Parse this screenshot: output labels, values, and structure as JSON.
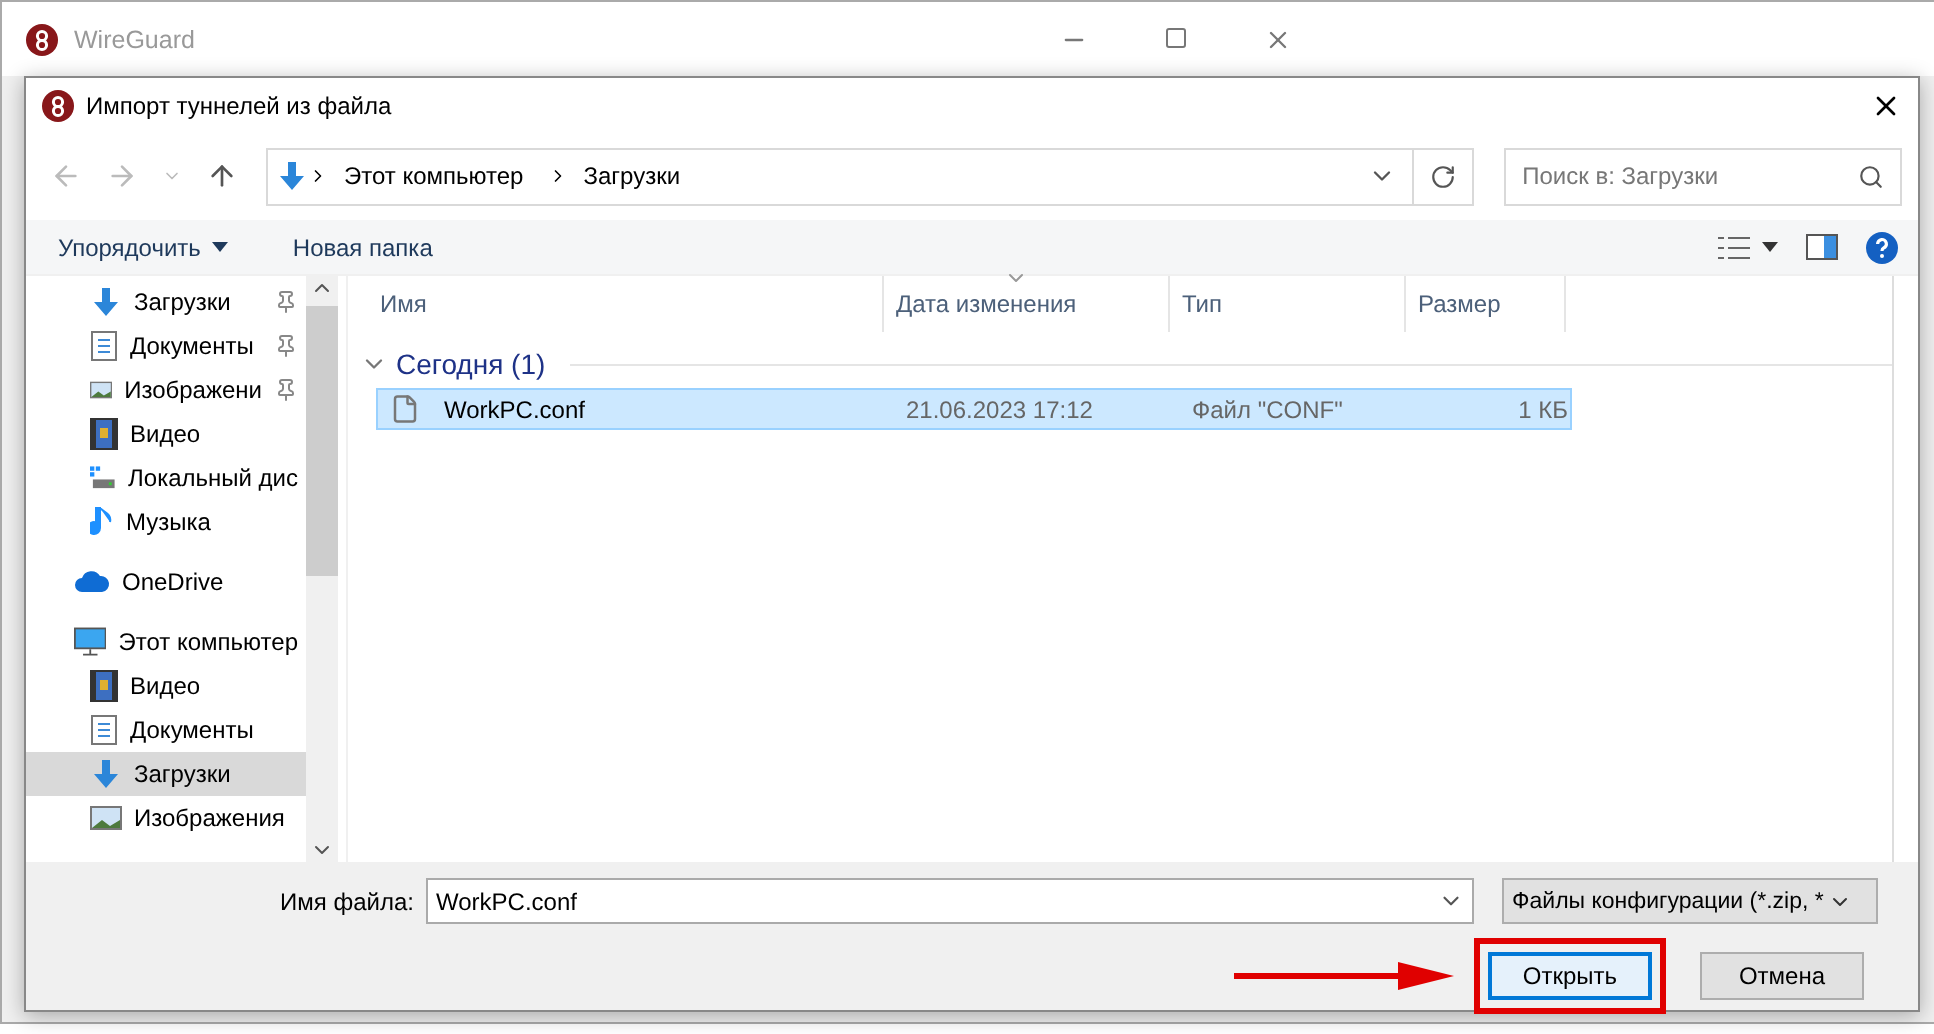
{
  "back_window": {
    "title": "WireGuard"
  },
  "dialog": {
    "title": "Импорт туннелей из файла"
  },
  "address": {
    "path": [
      "Этот компьютер",
      "Загрузки"
    ]
  },
  "search": {
    "placeholder": "Поиск в: Загрузки"
  },
  "toolbar": {
    "organize": "Упорядочить",
    "new_folder": "Новая папка"
  },
  "sidebar": {
    "items": [
      {
        "label": "Загрузки",
        "kind": "downloads",
        "pinned": true,
        "selected": false
      },
      {
        "label": "Документы",
        "kind": "documents",
        "pinned": true,
        "selected": false
      },
      {
        "label": "Изображени",
        "kind": "pictures",
        "pinned": true,
        "selected": false
      },
      {
        "label": "Видео",
        "kind": "videos",
        "pinned": false,
        "selected": false
      },
      {
        "label": "Локальный дис",
        "kind": "drive",
        "pinned": false,
        "selected": false
      },
      {
        "label": "Музыка",
        "kind": "music",
        "pinned": false,
        "selected": false
      },
      {
        "label": "OneDrive",
        "kind": "cloud",
        "selected": false
      },
      {
        "label": "Этот компьютер",
        "kind": "computer",
        "selected": false,
        "children": [
          {
            "label": "Видео",
            "kind": "videos",
            "pinned": false,
            "selected": false
          },
          {
            "label": "Документы",
            "kind": "documents",
            "pinned": false,
            "selected": false
          },
          {
            "label": "Загрузки",
            "kind": "downloads",
            "pinned": false,
            "selected": true
          },
          {
            "label": "Изображения",
            "kind": "pictures",
            "pinned": false,
            "selected": false
          }
        ]
      }
    ]
  },
  "table": {
    "columns": [
      "Имя",
      "Дата изменения",
      "Тип",
      "Размер"
    ],
    "groups": [
      {
        "label": "Сегодня (1)",
        "expanded": true,
        "rows": [
          {
            "name": "WorkPC.conf",
            "date": "21.06.2023 17:12",
            "type": "Файл \"CONF\"",
            "size": "1 КБ",
            "selected": true
          }
        ]
      }
    ]
  },
  "file_name": {
    "label": "Имя файла:",
    "value": "WorkPC.conf"
  },
  "file_type": {
    "value": "Файлы конфигурации (*.zip, *"
  },
  "buttons": [
    {
      "label": "Открыть",
      "default": true,
      "highlighted": true
    },
    {
      "label": "Отмена",
      "default": false,
      "highlighted": false
    }
  ],
  "pointer_arrow": true
}
